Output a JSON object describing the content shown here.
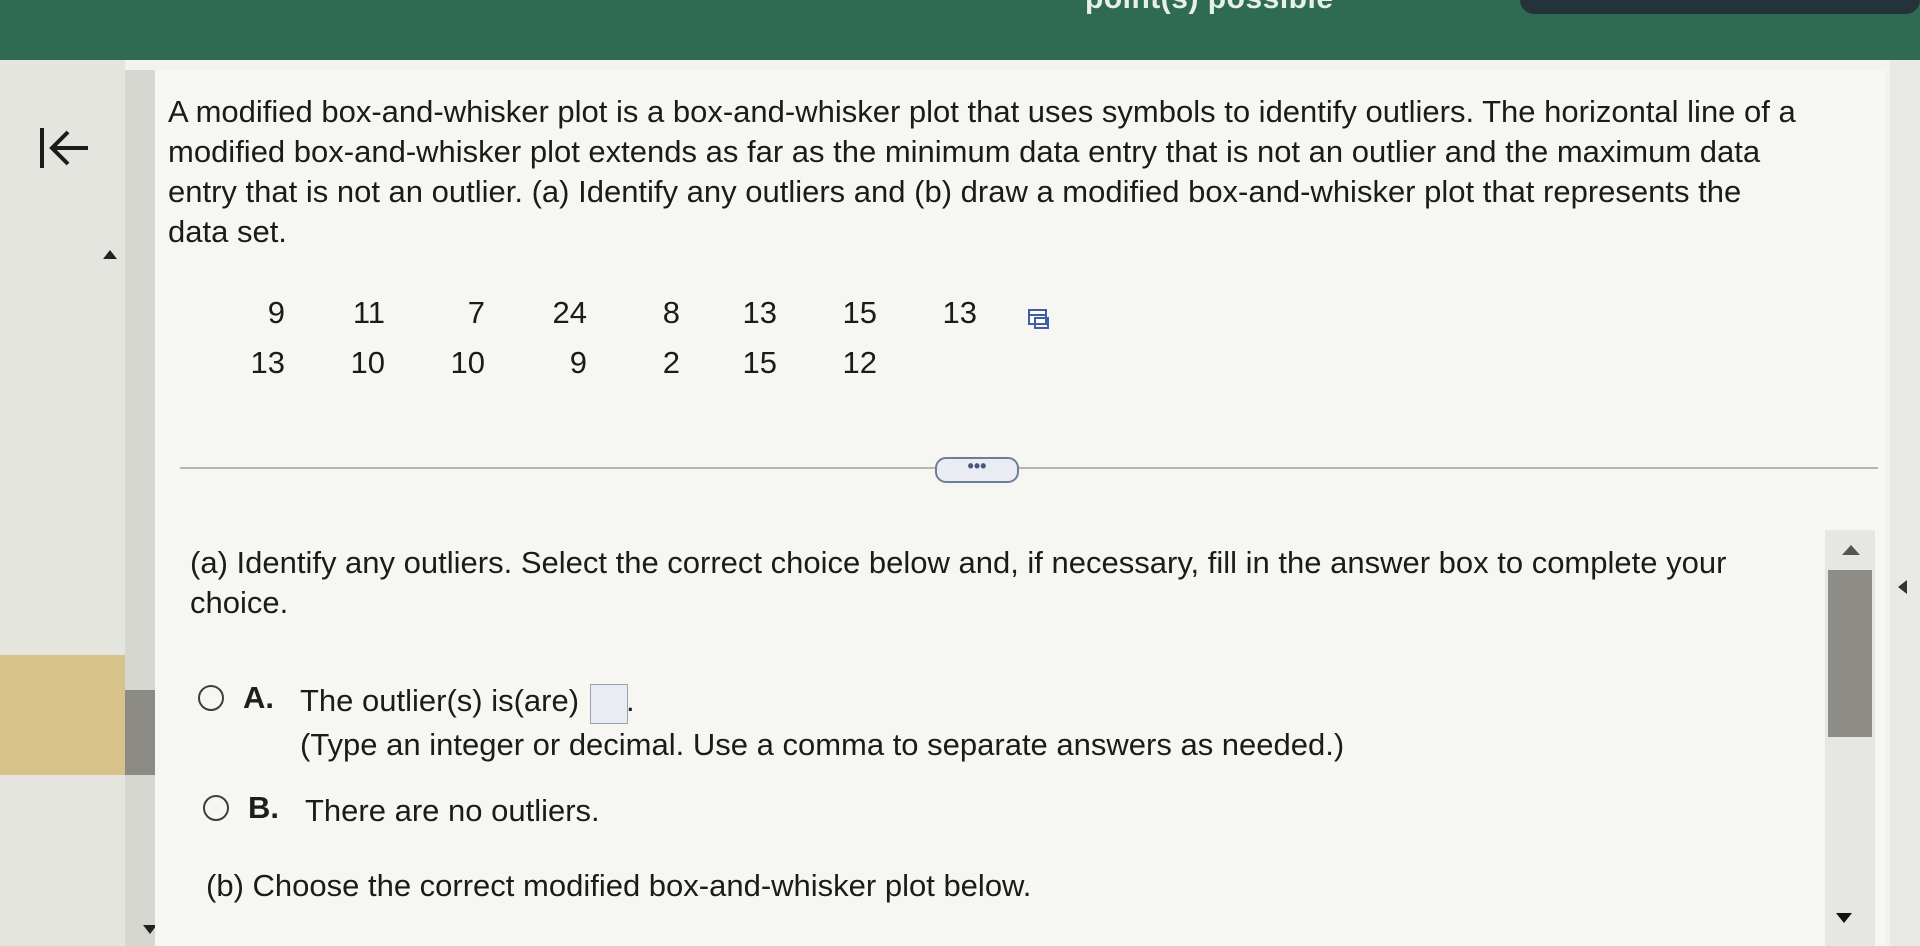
{
  "header": {
    "title_fragment": "point(s) possible"
  },
  "problem": {
    "lines": [
      "A modified box-and-whisker plot is a box-and-whisker plot that uses symbols to identify outliers. The horizontal line of a",
      "modified box-and-whisker plot extends as far as the minimum data entry that is not an outlier and the maximum data",
      "entry that is not an outlier. (a) Identify any outliers and (b) draw a modified box-and-whisker plot that represents the",
      "data set."
    ]
  },
  "data_set": {
    "row1": [
      "9",
      "11",
      "7",
      "24",
      "8",
      "13",
      "15",
      "13"
    ],
    "row2": [
      "13",
      "10",
      "10",
      "9",
      "2",
      "15",
      "12"
    ]
  },
  "divider": {
    "ellipsis_label": "•••"
  },
  "part_a": {
    "prompt_line1": "(a) Identify any outliers. Select the correct choice below and, if necessary, fill in the answer box to complete your",
    "prompt_line2": "choice.",
    "choice_a": {
      "letter": "A.",
      "text": "The outlier(s) is(are)",
      "suffix": ".",
      "hint": "(Type an integer or decimal. Use a comma to separate answers as needed.)",
      "answer_value": ""
    },
    "choice_b": {
      "letter": "B.",
      "text": "There are no outliers."
    }
  },
  "part_b": {
    "prompt": "(b) Choose the correct modified box-and-whisker plot below."
  }
}
